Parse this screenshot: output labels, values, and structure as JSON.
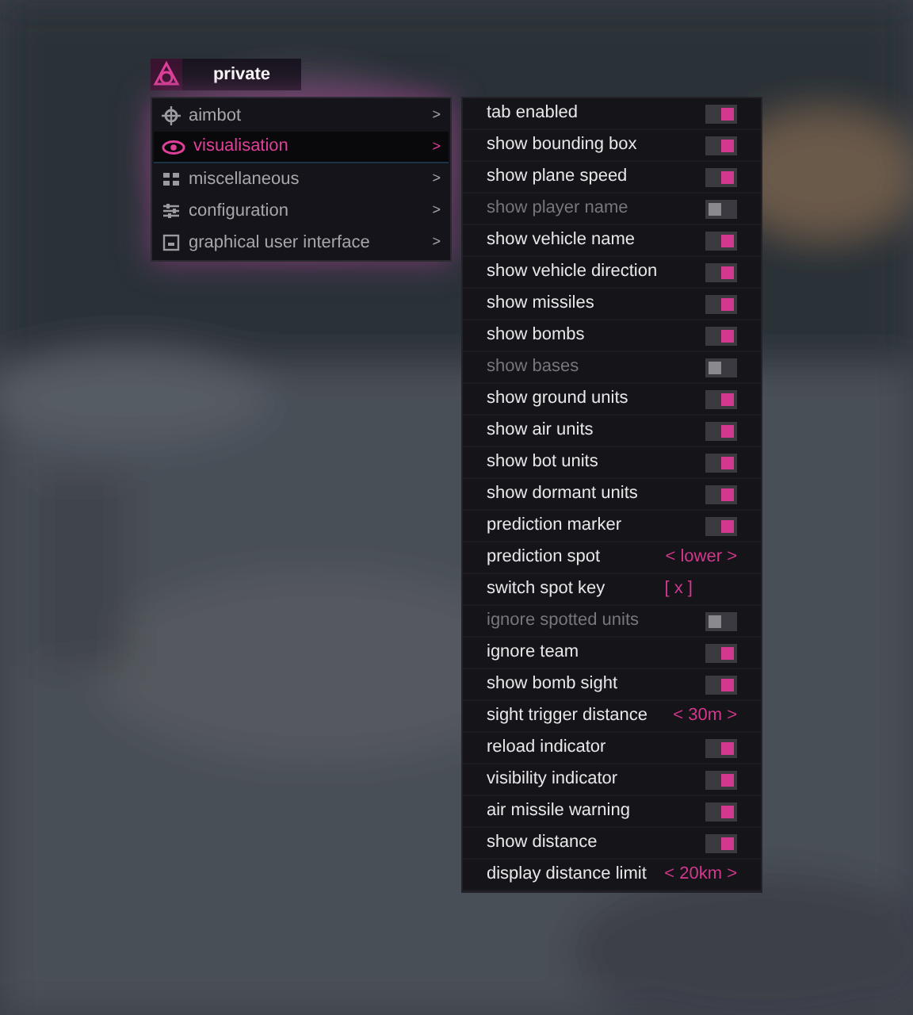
{
  "header": {
    "title": "private"
  },
  "menu": [
    {
      "label": "aimbot",
      "arrow": ">",
      "selected": false
    },
    {
      "label": "visualisation",
      "arrow": ">",
      "selected": true
    },
    {
      "label": "miscellaneous",
      "arrow": ">",
      "selected": false
    },
    {
      "label": "configuration",
      "arrow": ">",
      "selected": false
    },
    {
      "label": "graphical user interface",
      "arrow": ">",
      "selected": false
    }
  ],
  "settings": [
    {
      "kind": "toggle",
      "label": "tab enabled",
      "on": true
    },
    {
      "kind": "toggle",
      "label": "show bounding box",
      "on": true
    },
    {
      "kind": "toggle",
      "label": "show plane speed",
      "on": true
    },
    {
      "kind": "toggle",
      "label": "show player name",
      "on": false
    },
    {
      "kind": "toggle",
      "label": "show vehicle name",
      "on": true
    },
    {
      "kind": "toggle",
      "label": "show vehicle direction",
      "on": true
    },
    {
      "kind": "toggle",
      "label": "show missiles",
      "on": true
    },
    {
      "kind": "toggle",
      "label": "show bombs",
      "on": true
    },
    {
      "kind": "toggle",
      "label": "show bases",
      "on": false
    },
    {
      "kind": "toggle",
      "label": "show ground units",
      "on": true
    },
    {
      "kind": "toggle",
      "label": "show air units",
      "on": true
    },
    {
      "kind": "toggle",
      "label": "show bot units",
      "on": true
    },
    {
      "kind": "toggle",
      "label": "show dormant units",
      "on": true
    },
    {
      "kind": "toggle",
      "label": "prediction marker",
      "on": true
    },
    {
      "kind": "selector",
      "label": "prediction spot",
      "value": "< lower >"
    },
    {
      "kind": "key",
      "label": "switch spot key",
      "value": "[ x ]"
    },
    {
      "kind": "toggle",
      "label": "ignore spotted units",
      "on": false
    },
    {
      "kind": "toggle",
      "label": "ignore team",
      "on": true
    },
    {
      "kind": "toggle",
      "label": "show bomb sight",
      "on": true
    },
    {
      "kind": "selector",
      "label": "sight trigger distance",
      "value": "< 30m >"
    },
    {
      "kind": "toggle",
      "label": "reload indicator",
      "on": true
    },
    {
      "kind": "toggle",
      "label": "visibility indicator",
      "on": true
    },
    {
      "kind": "toggle",
      "label": "air missile warning",
      "on": true
    },
    {
      "kind": "toggle",
      "label": "show distance",
      "on": true
    },
    {
      "kind": "selector",
      "label": "display distance limit",
      "value": "< 20km >"
    }
  ]
}
